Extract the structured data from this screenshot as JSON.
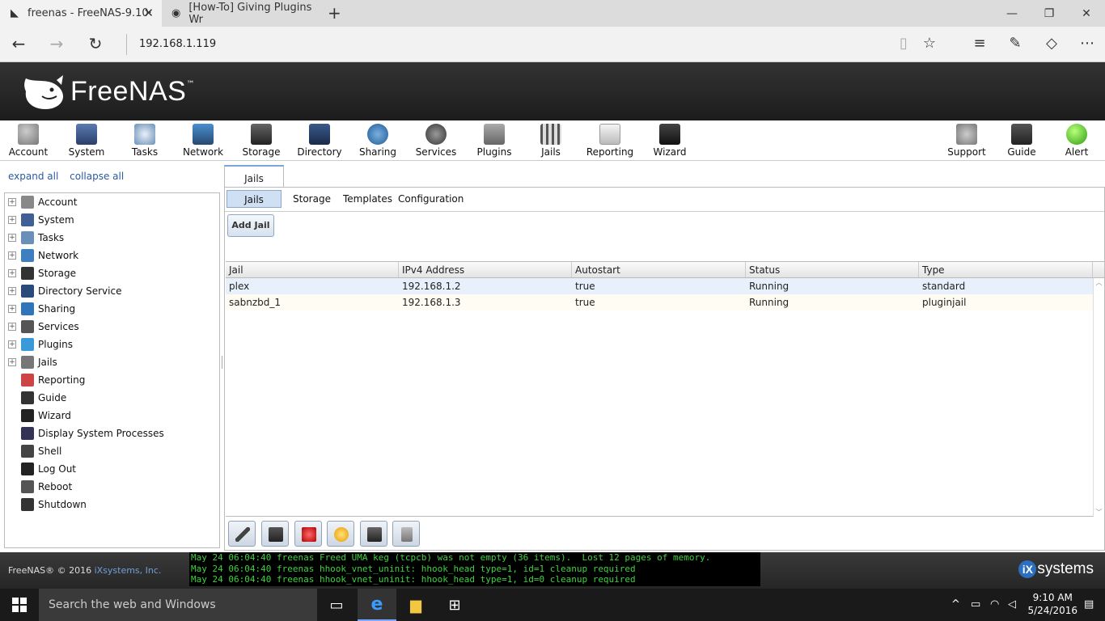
{
  "browser": {
    "tabs": [
      {
        "title": "freenas - FreeNAS-9.10·",
        "active": true
      },
      {
        "title": "[How-To] Giving Plugins Wr",
        "active": false
      }
    ],
    "address": "192.168.1.119"
  },
  "app": {
    "brand": "FreeNAS",
    "toolbar": [
      "Account",
      "System",
      "Tasks",
      "Network",
      "Storage",
      "Directory",
      "Sharing",
      "Services",
      "Plugins",
      "Jails",
      "Reporting",
      "Wizard"
    ],
    "toolbar_right": [
      "Support",
      "Guide",
      "Alert"
    ]
  },
  "tree": {
    "expand_all": "expand all",
    "collapse_all": "collapse all",
    "items": [
      {
        "label": "Account",
        "expandable": true
      },
      {
        "label": "System",
        "expandable": true
      },
      {
        "label": "Tasks",
        "expandable": true
      },
      {
        "label": "Network",
        "expandable": true
      },
      {
        "label": "Storage",
        "expandable": true
      },
      {
        "label": "Directory Service",
        "expandable": true
      },
      {
        "label": "Sharing",
        "expandable": true
      },
      {
        "label": "Services",
        "expandable": true
      },
      {
        "label": "Plugins",
        "expandable": true
      },
      {
        "label": "Jails",
        "expandable": true
      },
      {
        "label": "Reporting",
        "expandable": false
      },
      {
        "label": "Guide",
        "expandable": false
      },
      {
        "label": "Wizard",
        "expandable": false
      },
      {
        "label": "Display System Processes",
        "expandable": false
      },
      {
        "label": "Shell",
        "expandable": false
      },
      {
        "label": "Log Out",
        "expandable": false
      },
      {
        "label": "Reboot",
        "expandable": false
      },
      {
        "label": "Shutdown",
        "expandable": false
      }
    ]
  },
  "main": {
    "tab": "Jails",
    "subtabs": [
      "Jails",
      "Storage",
      "Templates",
      "Configuration"
    ],
    "add_button": "Add Jail",
    "columns": [
      "Jail",
      "IPv4 Address",
      "Autostart",
      "Status",
      "Type"
    ],
    "rows": [
      [
        "plex",
        "192.168.1.2",
        "true",
        "Running",
        "standard"
      ],
      [
        "sabnzbd_1",
        "192.168.1.3",
        "true",
        "Running",
        "pluginjail"
      ]
    ]
  },
  "footer": {
    "copyright": "FreeNAS® © 2016 ",
    "company": "iXsystems, Inc.",
    "console": [
      "May 24 06:04:40 freenas Freed UMA keg (tcpcb) was not empty (36 items).  Lost 12 pages of memory.",
      "May 24 06:04:40 freenas hhook_vnet_uninit: hhook_head type=1, id=1 cleanup required",
      "May 24 06:04:40 freenas hhook_vnet_uninit: hhook_head type=1, id=0 cleanup required"
    ],
    "vendor_logo": "systems"
  },
  "taskbar": {
    "search_placeholder": "Search the web and Windows",
    "time": "9:10 AM",
    "date": "5/24/2016"
  }
}
